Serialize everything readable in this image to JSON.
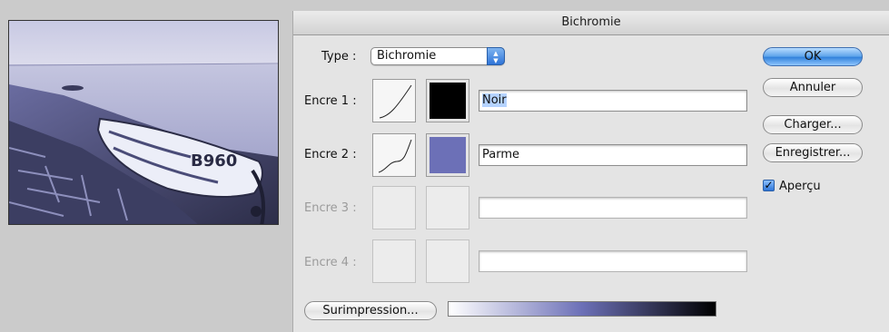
{
  "dialog": {
    "title": "Bichromie"
  },
  "type": {
    "label": "Type :",
    "value": "Bichromie"
  },
  "inks": [
    {
      "label": "Encre 1 :",
      "name": "Noir",
      "color": "#000000",
      "enabled": true
    },
    {
      "label": "Encre 2 :",
      "name": "Parme",
      "color": "#6c70b7",
      "enabled": true
    },
    {
      "label": "Encre 3 :",
      "name": "",
      "color": "",
      "enabled": false
    },
    {
      "label": "Encre 4 :",
      "name": "",
      "color": "",
      "enabled": false
    }
  ],
  "buttons": {
    "ok": "OK",
    "cancel": "Annuler",
    "load": "Charger...",
    "save": "Enregistrer...",
    "overprint": "Surimpression..."
  },
  "preview": {
    "label": "Aperçu",
    "checked": true
  },
  "photo": {
    "boat_marking": "B960"
  },
  "colors": {
    "accent": "#3b82e0",
    "overprint_gradient": [
      "#ffffff",
      "#6c70b7",
      "#000000"
    ]
  }
}
